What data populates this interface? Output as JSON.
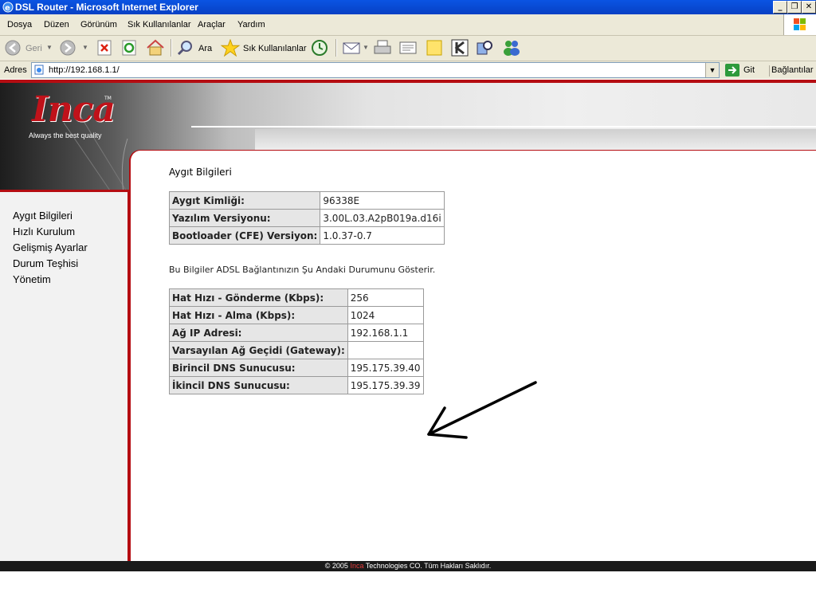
{
  "window": {
    "title": "DSL Router - Microsoft Internet Explorer"
  },
  "menu": [
    "Dosya",
    "Düzen",
    "Görünüm",
    "Sık Kullanılanlar",
    "Araçlar",
    "Yardım"
  ],
  "toolbar": {
    "back_label": "Geri",
    "search_label": "Ara",
    "favorites_label": "Sık Kullanılanlar"
  },
  "address": {
    "label": "Adres",
    "url": "http://192.168.1.1/",
    "go_label": "Git",
    "links_label": "Bağlantılar"
  },
  "brand": {
    "logo_text": "Inca",
    "tm": "TM",
    "tagline": "Always the best quality"
  },
  "nav": [
    "Aygıt Bilgileri",
    "Hızlı Kurulum",
    "Gelişmiş Ayarlar",
    "Durum Teşhisi",
    "Yönetim"
  ],
  "page": {
    "title": "Aygıt Bilgileri",
    "device_table": [
      {
        "label": "Aygıt Kimliği:",
        "value": "96338E"
      },
      {
        "label": "Yazılım Versiyonu:",
        "value": "3.00L.03.A2pB019a.d16i"
      },
      {
        "label": "Bootloader (CFE) Versiyon:",
        "value": "1.0.37-0.7"
      }
    ],
    "description": "Bu Bilgiler ADSL Bağlantınızın Şu Andaki Durumunu Gösterir.",
    "adsl_table": [
      {
        "label": "Hat Hızı - Gönderme (Kbps):",
        "value": "256"
      },
      {
        "label": "Hat Hızı - Alma (Kbps):",
        "value": "1024"
      },
      {
        "label": "Ağ IP Adresi:",
        "value": "192.168.1.1"
      },
      {
        "label": "Varsayılan Ağ Geçidi (Gateway):",
        "value": ""
      },
      {
        "label": "Birincil DNS Sunucusu:",
        "value": "195.175.39.40"
      },
      {
        "label": "İkincil DNS Sunucusu:",
        "value": "195.175.39.39"
      }
    ]
  },
  "footer": {
    "prefix": "© 2005 ",
    "brand": "Inca",
    "suffix": " Technologies CO. Tüm Hakları Saklıdır."
  },
  "colors": {
    "accent": "#b50d12",
    "title_bar": "#0a54e3",
    "chrome": "#ece9d8"
  }
}
